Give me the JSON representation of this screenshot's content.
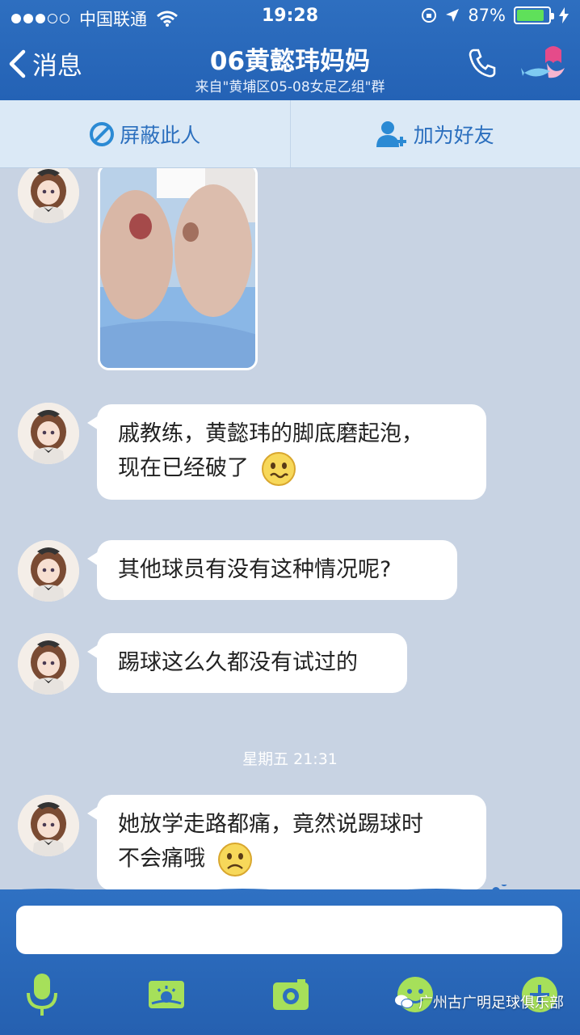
{
  "status_bar": {
    "carrier": "中国联通",
    "time": "19:28",
    "battery": "87%",
    "battery_level": 0.87
  },
  "nav": {
    "back_label": "消息",
    "title": "06黄懿玮妈妈",
    "subtitle": "来自\"黄埔区05-08女足乙组\"群"
  },
  "actions": {
    "block": "屏蔽此人",
    "add_friend": "加为好友"
  },
  "messages": [
    {
      "type": "image",
      "icon": "photo-of-blistered-feet"
    },
    {
      "type": "text",
      "line1": "戚教练，黄懿玮的脚底磨起泡，",
      "line2": "现在已经破了",
      "emoji": "wavy-mouth-emoji"
    },
    {
      "type": "text",
      "line1": "其他球员有没有这种情况呢?"
    },
    {
      "type": "text",
      "line1": "踢球这么久都没有试过的"
    },
    {
      "type": "text",
      "line1": "她放学走路都痛，竟然说踢球时",
      "line2": "不会痛哦",
      "emoji": "sad-emoji"
    }
  ],
  "timestamp": "星期五 21:31",
  "input": {
    "value": ""
  },
  "toolbar": [
    "microphone-icon",
    "picture-icon",
    "camera-icon",
    "emoji-icon",
    "plus-icon"
  ],
  "watermark": "广州古广明足球俱乐部",
  "colors": {
    "nav": "#2b69bb",
    "accent": "#2b6fbe",
    "chat_bg": "#c8d3e3",
    "bubble": "#ffffff",
    "battery": "#5fe05a"
  }
}
